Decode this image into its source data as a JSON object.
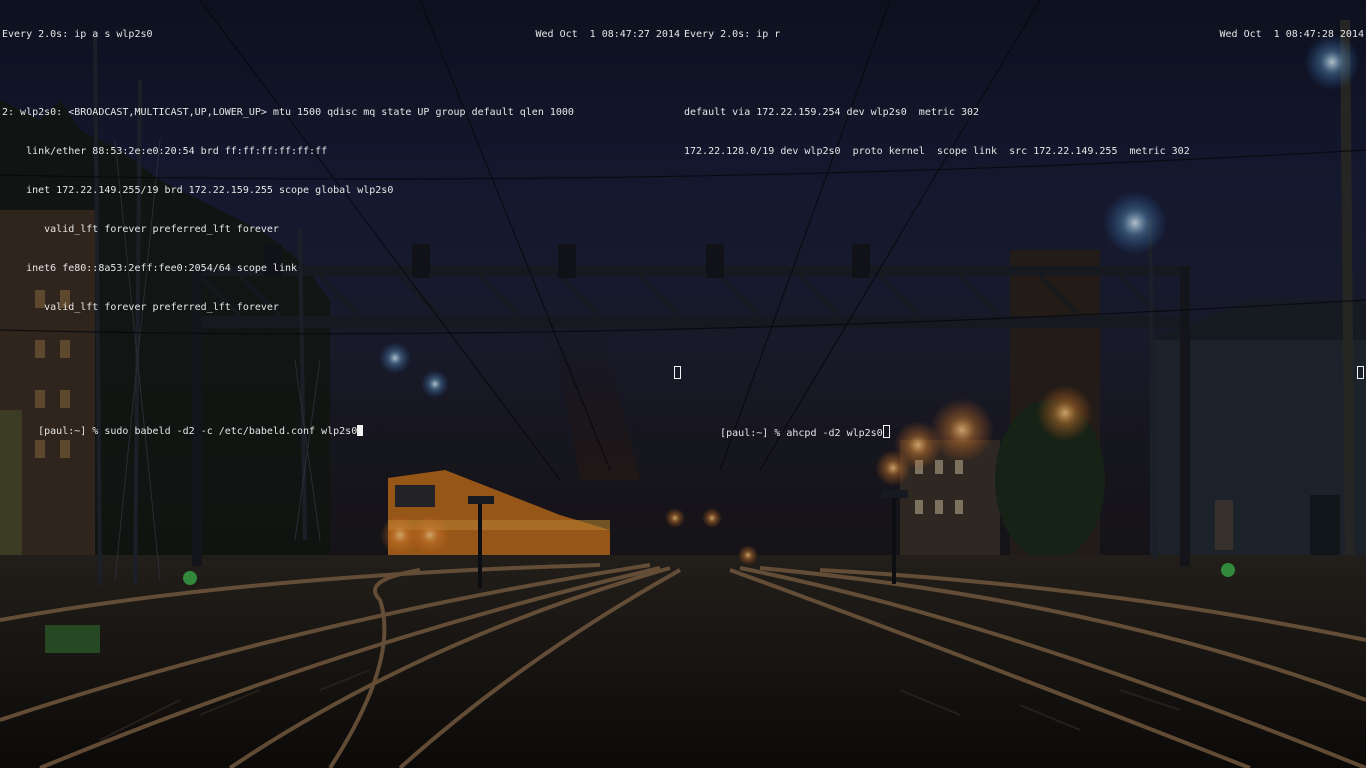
{
  "watch_ip_addr": {
    "header_left": "Every 2.0s: ip a s wlp2s0",
    "header_right": "Wed Oct  1 08:47:27 2014",
    "output": [
      "2: wlp2s0: <BROADCAST,MULTICAST,UP,LOWER_UP> mtu 1500 qdisc mq state UP group default qlen 1000",
      "    link/ether 88:53:2e:e0:20:54 brd ff:ff:ff:ff:ff:ff",
      "    inet 172.22.149.255/19 brd 172.22.159.255 scope global wlp2s0",
      "       valid_lft forever preferred_lft forever",
      "    inet6 fe80::8a53:2eff:fee0:2054/64 scope link",
      "       valid_lft forever preferred_lft forever"
    ]
  },
  "watch_ip_route": {
    "header_left": "Every 2.0s: ip r",
    "header_right": "Wed Oct  1 08:47:28 2014",
    "output": [
      "default via 172.22.159.254 dev wlp2s0  metric 302",
      "172.22.128.0/19 dev wlp2s0  proto kernel  scope link  src 172.22.149.255  metric 302"
    ]
  },
  "terminal_babeld": {
    "prompt": "[paul:~] % ",
    "command": "sudo babeld -d2 -c /etc/babeld.conf wlp2s0"
  },
  "terminal_ahcpd": {
    "prompt": "[paul:~] % ",
    "command": "ahcpd -d2 wlp2s0"
  },
  "colors": {
    "text": "#e6e6e6",
    "cursor": "#f2f2f2",
    "sky": "#1a1f3a",
    "lamp": "#ffb450"
  }
}
